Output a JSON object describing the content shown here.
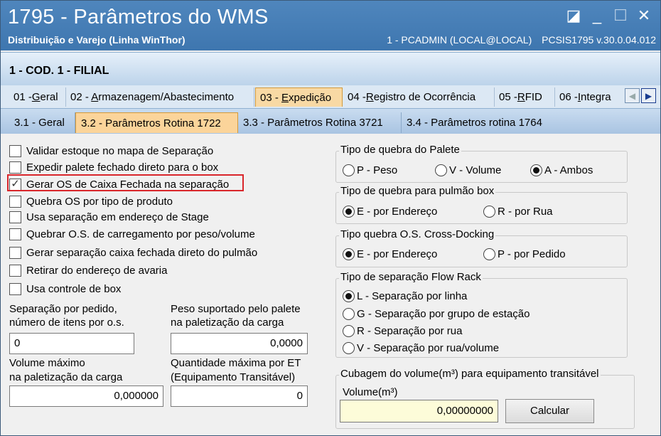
{
  "window": {
    "title": "1795 - Parâmetros do WMS",
    "subtitle": "Distribuição e Varejo (Linha WinThor)",
    "user": "1 - PCADMIN (LOCAL@LOCAL)",
    "version": "PCSIS1795  v.30.0.04.012",
    "controls": {
      "restore": "◪",
      "minimize": "_",
      "maximize": "☐",
      "close": "✕"
    }
  },
  "filial": "1 - COD. 1 - FILIAL",
  "main_tabs": [
    {
      "num": "01 -",
      "u": "G",
      "rest": "eral"
    },
    {
      "num": "02 - ",
      "u": "A",
      "rest": "rmazenagem/Abastecimento"
    },
    {
      "num": "03 - ",
      "u": "E",
      "rest": "xpedição"
    },
    {
      "num": "04 -",
      "u": "R",
      "rest": "egistro de Ocorrência"
    },
    {
      "num": "05 -",
      "u": "R",
      "rest": "FID"
    },
    {
      "num": "06 -",
      "u": "I",
      "rest": "ntegra"
    }
  ],
  "tab_scroll": {
    "left": "◀",
    "right": "▶"
  },
  "sub_tabs": [
    "3.1 - Geral",
    "3.2 - Parâmetros Rotina 1722",
    "3.3 - Parâmetros Rotina 3721",
    "3.4 - Parâmetros rotina 1764"
  ],
  "checkboxes": [
    {
      "label": "Validar estoque no mapa de Separação",
      "checked": false
    },
    {
      "label": "Expedir palete fechado direto para o box",
      "checked": false
    },
    {
      "label": "Gerar OS de Caixa Fechada na separação",
      "checked": true
    },
    {
      "label": "Quebra OS por tipo de produto",
      "checked": false
    },
    {
      "label": "Usa separação em endereço de Stage",
      "checked": false
    },
    {
      "label": "Quebrar O.S. de carregamento por peso/volume",
      "checked": false
    },
    {
      "label": "Gerar separação caixa fechada direto do pulmão",
      "checked": false
    },
    {
      "label": "Retirar do endereço de avaria",
      "checked": false
    },
    {
      "label": "Usa controle de box",
      "checked": false
    }
  ],
  "check_mark": "✓",
  "fields": {
    "sep_pedido_label1": "Separação por pedido,",
    "sep_pedido_label2": "número de itens por o.s.",
    "sep_pedido_value": "0",
    "peso_label1": "Peso suportado pelo palete",
    "peso_label2": "na paletização da carga",
    "peso_value": "0,0000",
    "volume_label1": "Volume máximo",
    "volume_label2": "na paletização da carga",
    "volume_value": "0,000000",
    "qtd_label1": "Quantidade máxima por ET",
    "qtd_label2": "(Equipamento Transitável)",
    "qtd_value": "0"
  },
  "groups": {
    "quebra_palete": {
      "title": "Tipo de quebra do Palete",
      "options": [
        "P - Peso",
        "V - Volume",
        "A - Ambos"
      ],
      "selected": 2
    },
    "quebra_pulmao": {
      "title": "Tipo de quebra para pulmão box",
      "options": [
        "E - por Endereço",
        "R - por Rua"
      ],
      "selected": 0
    },
    "cross_docking": {
      "title": "Tipo quebra O.S. Cross-Docking",
      "options": [
        "E - por Endereço",
        "P - por Pedido"
      ],
      "selected": 0
    },
    "flow_rack": {
      "title": "Tipo de separação Flow Rack",
      "options": [
        "L - Separação por linha",
        "G - Separação por grupo de estação",
        "R - Separação por rua",
        "V - Separação por rua/volume"
      ],
      "selected": 0
    },
    "cubagem": {
      "title": "Cubagem do volume(m³) para equipamento transitável",
      "field_label": "Volume(m³)",
      "value": "0,00000000",
      "button": "Calcular"
    }
  }
}
